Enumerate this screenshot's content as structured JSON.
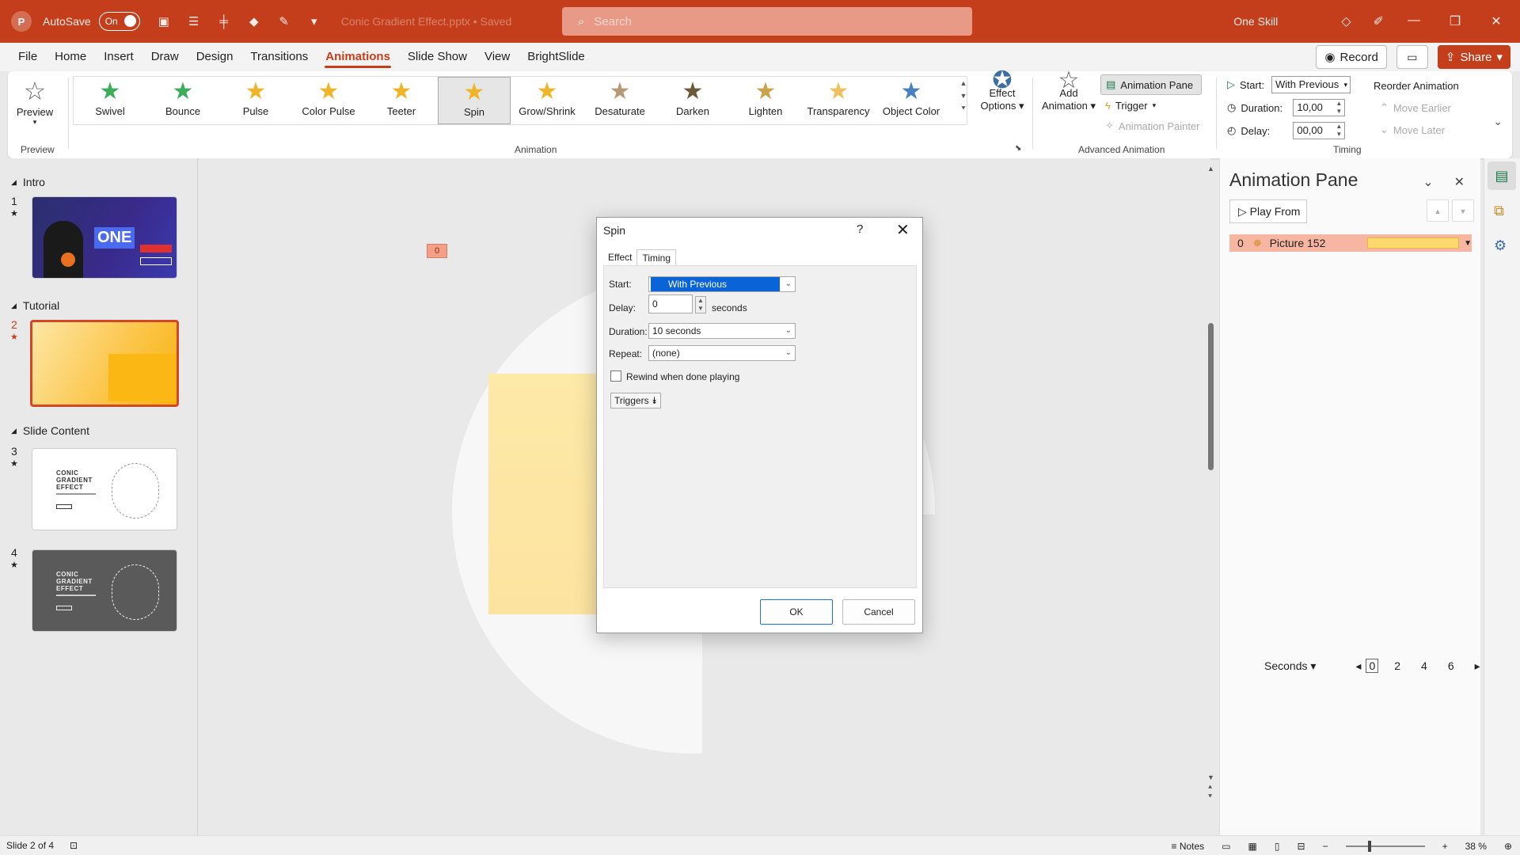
{
  "titlebar": {
    "autosave_label": "AutoSave",
    "autosave_state": "On",
    "filename": "Conic Gradient Effect.pptx • Saved",
    "search_placeholder": "Search",
    "user": "One Skill"
  },
  "menu": {
    "tabs": [
      "File",
      "Home",
      "Insert",
      "Draw",
      "Design",
      "Transitions",
      "Animations",
      "Slide Show",
      "View",
      "BrightSlide"
    ],
    "active": "Animations",
    "record": "Record",
    "share": "Share"
  },
  "ribbon": {
    "preview": "Preview",
    "preview_group": "Preview",
    "animations": [
      {
        "label": "Swivel",
        "color": "#3cae5a"
      },
      {
        "label": "Bounce",
        "color": "#3cae5a"
      },
      {
        "label": "Pulse",
        "color": "#f0b429"
      },
      {
        "label": "Color Pulse",
        "color": "#f0b429"
      },
      {
        "label": "Teeter",
        "color": "#f0b429"
      },
      {
        "label": "Spin",
        "color": "#f0b429"
      },
      {
        "label": "Grow/Shrink",
        "color": "#f0b429"
      },
      {
        "label": "Desaturate",
        "color": "#b59a7a"
      },
      {
        "label": "Darken",
        "color": "#6b5a3a"
      },
      {
        "label": "Lighten",
        "color": "#c9a24a"
      },
      {
        "label": "Transparency",
        "color": "#f0c060"
      },
      {
        "label": "Object Color",
        "color": "#4a7fc0"
      }
    ],
    "selected_animation": "Spin",
    "animation_group": "Animation",
    "effect_options_l1": "Effect",
    "effect_options_l2": "Options",
    "add_animation_l1": "Add",
    "add_animation_l2": "Animation",
    "animation_pane": "Animation Pane",
    "trigger": "Trigger",
    "animation_painter": "Animation Painter",
    "advanced_group": "Advanced Animation",
    "start_label": "Start:",
    "start_value": "With Previous",
    "duration_label": "Duration:",
    "duration_value": "10,00",
    "delay_label": "Delay:",
    "delay_value": "00,00",
    "timing_group": "Timing",
    "reorder": "Reorder Animation",
    "move_earlier": "Move Earlier",
    "move_later": "Move Later"
  },
  "slides": {
    "sections": [
      "Intro",
      "Tutorial",
      "Slide Content"
    ],
    "numbers": [
      "1",
      "2",
      "3",
      "4"
    ],
    "thumb1_text": "ONE",
    "thumb_title": "CONIC GRADIENT EFFECT"
  },
  "slide": {
    "anim_badge": "0"
  },
  "dialog": {
    "title": "Spin",
    "help": "?",
    "tabs": [
      "Effect",
      "Timing"
    ],
    "active_tab": "Timing",
    "start_label": "Start:",
    "start_value": "With Previous",
    "delay_label": "Delay:",
    "delay_value": "0",
    "delay_unit": "seconds",
    "duration_label": "Duration:",
    "duration_value": "10 seconds",
    "repeat_label": "Repeat:",
    "repeat_value": "(none)",
    "rewind_label": "Rewind when done playing",
    "triggers": "Triggers",
    "ok": "OK",
    "cancel": "Cancel"
  },
  "pane": {
    "title": "Animation Pane",
    "play_from": "Play From",
    "item_num": "0",
    "item_name": "Picture 152",
    "seconds": "Seconds",
    "timeline": [
      "0",
      "2",
      "4",
      "6"
    ]
  },
  "status": {
    "slide": "Slide 2 of 4",
    "notes": "Notes",
    "zoom": "38 %"
  },
  "colors": {
    "accent": "#c43e1c",
    "dialog_selection": "#0a64d8"
  }
}
